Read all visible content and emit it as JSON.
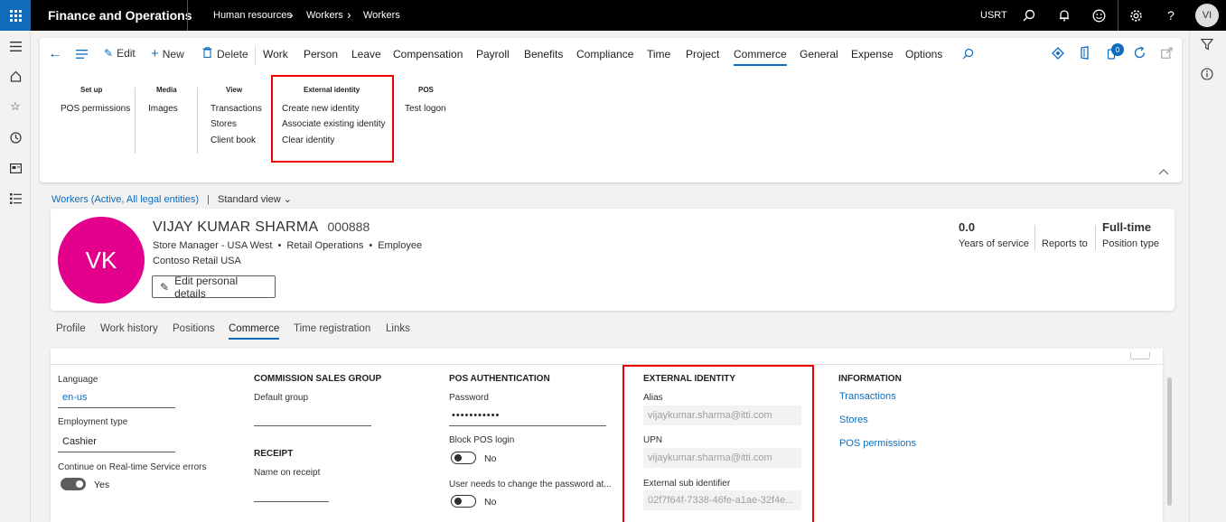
{
  "topbar": {
    "app_name": "Finance and Operations",
    "breadcrumbs": [
      "Human resources",
      "Workers",
      "Workers"
    ],
    "company": "USRT",
    "user_initials": "VI"
  },
  "ribbon": {
    "actions": [
      "Edit",
      "New",
      "Delete"
    ],
    "tabs": [
      "Work",
      "Person",
      "Leave",
      "Compensation",
      "Payroll",
      "Benefits",
      "Compliance",
      "Time",
      "Project",
      "Commerce",
      "General",
      "Expense",
      "Options"
    ],
    "active_tab": "Commerce",
    "notification_count": "0",
    "groups": [
      {
        "title": "Set up",
        "items": [
          "POS permissions"
        ]
      },
      {
        "title": "Media",
        "items": [
          "Images"
        ]
      },
      {
        "title": "View",
        "items": [
          "Transactions",
          "Stores",
          "Client book"
        ]
      },
      {
        "title": "External identity",
        "items": [
          "Create new identity",
          "Associate existing identity",
          "Clear identity"
        ]
      },
      {
        "title": "POS",
        "items": [
          "Test logon"
        ]
      }
    ]
  },
  "page": {
    "list_link": "Workers (Active, All legal entities)",
    "view_name": "Standard view"
  },
  "worker": {
    "initials": "VK",
    "name": "VIJAY KUMAR SHARMA",
    "id": "000888",
    "title": "Store Manager - USA West",
    "department": "Retail Operations",
    "worker_type": "Employee",
    "company": "Contoso Retail USA",
    "edit_button": "Edit personal details",
    "years_of_service": "0.0",
    "years_of_service_label": "Years of service",
    "reports_to_label": "Reports to",
    "position_type": "Full-time",
    "position_type_label": "Position type"
  },
  "fasttabs": [
    "Profile",
    "Work history",
    "Positions",
    "Commerce",
    "Time registration",
    "Links"
  ],
  "active_fasttab": "Commerce",
  "commerce": {
    "language_label": "Language",
    "language": "en-us",
    "employment_type_label": "Employment type",
    "employment_type": "Cashier",
    "realtime_label": "Continue on Real-time Service errors",
    "realtime_value": "Yes",
    "commission_header": "COMMISSION SALES GROUP",
    "default_group_label": "Default group",
    "default_group": "",
    "receipt_header": "RECEIPT",
    "name_on_receipt_label": "Name on receipt",
    "name_on_receipt": "",
    "pos_auth_header": "POS AUTHENTICATION",
    "password_label": "Password",
    "password": "•••••••••••",
    "block_login_label": "Block POS login",
    "block_login_value": "No",
    "change_password_label": "User needs to change the password at...",
    "change_password_value": "No",
    "external_identity_header": "EXTERNAL IDENTITY",
    "alias_label": "Alias",
    "alias": "vijaykumar.sharma@itti.com",
    "upn_label": "UPN",
    "upn": "vijaykumar.sharma@itti.com",
    "sub_id_label": "External sub identifier",
    "sub_id": "02f7f64f-7338-46fe-a1ae-32f4e...",
    "information_header": "INFORMATION",
    "info_links": [
      "Transactions",
      "Stores",
      "POS permissions"
    ]
  },
  "colors": {
    "accent": "#0f6cbd",
    "avatar": "#e3008c",
    "highlight": "#ee0000"
  }
}
